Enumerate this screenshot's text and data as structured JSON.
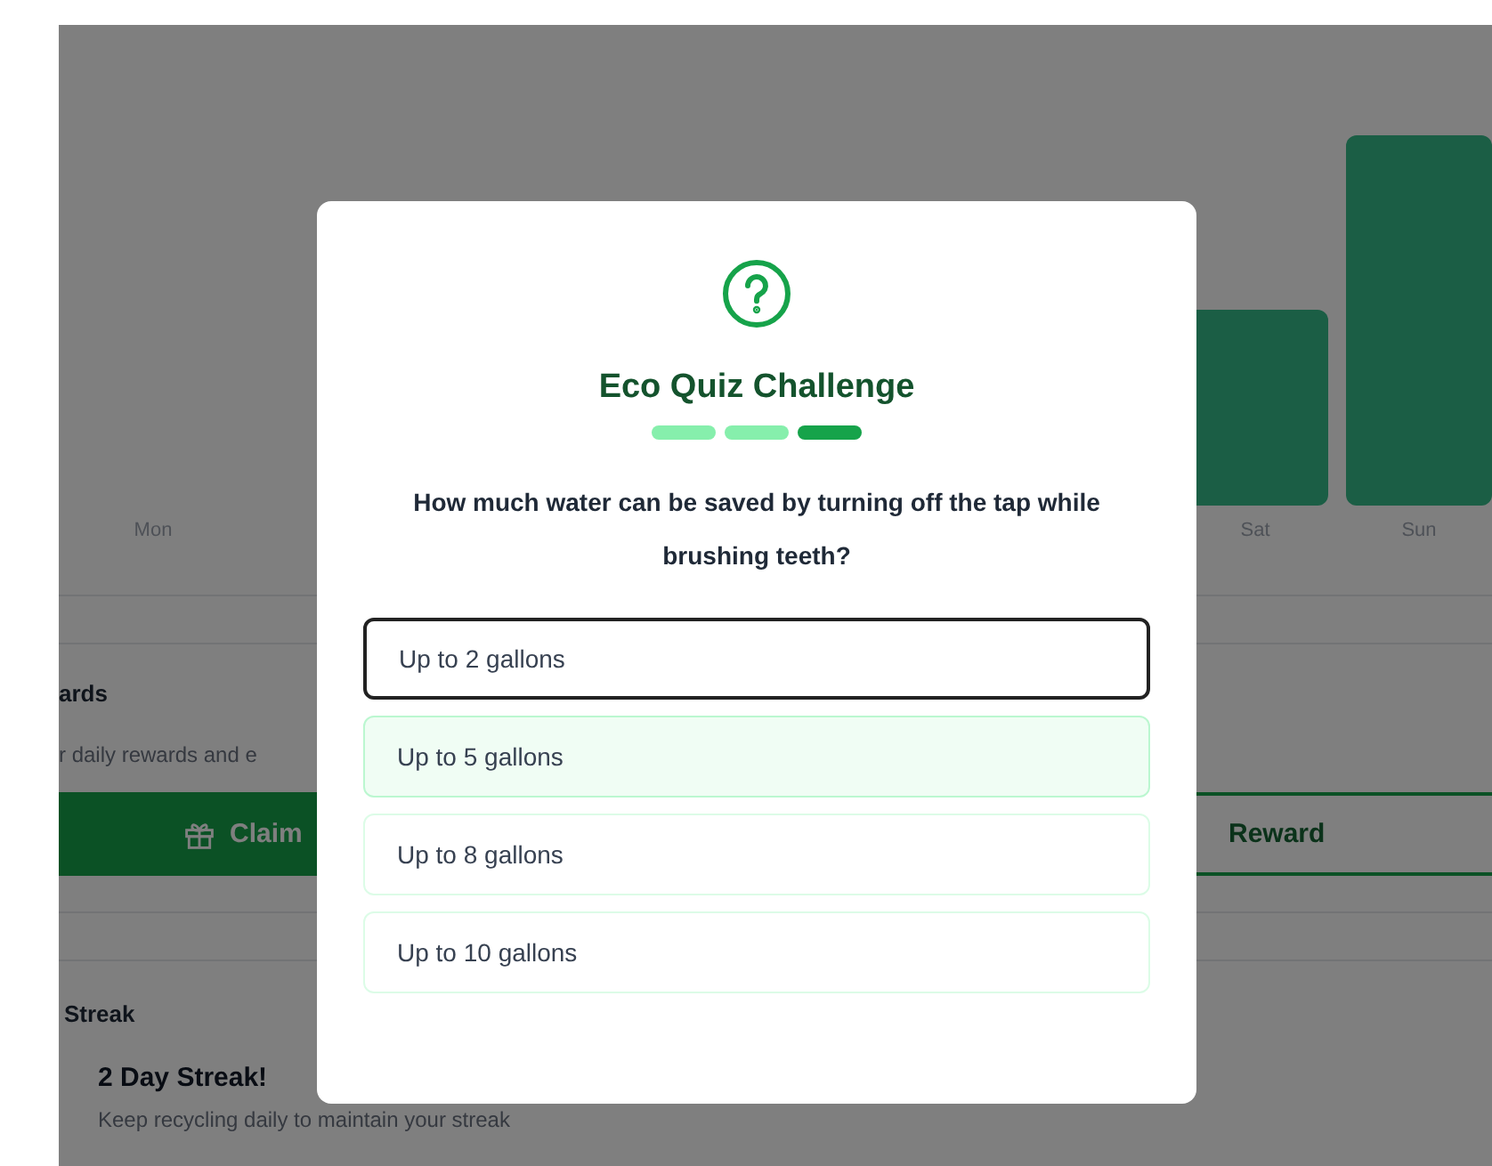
{
  "activity_chart": {
    "days": [
      {
        "label": "Mon"
      },
      {
        "label": "Sat"
      },
      {
        "label": "Sun"
      }
    ]
  },
  "rewards": {
    "heading": "ards",
    "description": "r daily rewards and e",
    "buttons": [
      {
        "kind": "primary",
        "label": "Claim"
      },
      {
        "kind": "outline",
        "label": "Reward"
      }
    ]
  },
  "streak": {
    "heading": "Streak",
    "title": "2 Day Streak!",
    "description": "Keep recycling daily to maintain your streak"
  },
  "quiz_modal": {
    "title": "Eco Quiz Challenge",
    "progress": [
      {
        "active": false
      },
      {
        "active": false
      },
      {
        "active": true
      }
    ],
    "question": "How much water can be saved by turning off the tap while brushing teeth?",
    "options": [
      {
        "label": "Up to 2 gallons",
        "selected": true,
        "hovered": false
      },
      {
        "label": "Up to 5 gallons",
        "selected": false,
        "hovered": true
      },
      {
        "label": "Up to 8 gallons",
        "selected": false,
        "hovered": false
      },
      {
        "label": "Up to 10 gallons",
        "selected": false,
        "hovered": false
      }
    ]
  }
}
